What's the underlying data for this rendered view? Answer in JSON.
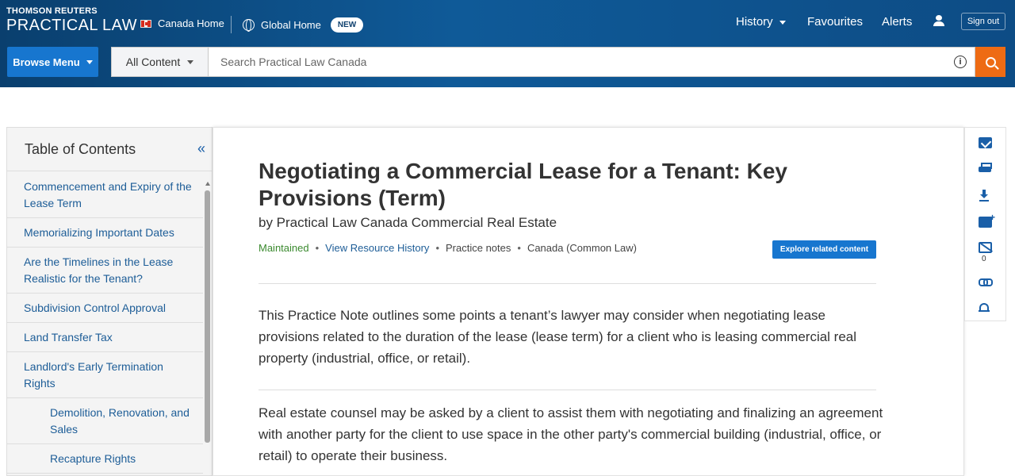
{
  "header": {
    "brand_top": "THOMSON REUTERS",
    "brand_bottom": "PRACTICAL LAW",
    "canada_home": "Canada Home",
    "global_home": "Global Home",
    "new_badge": "NEW",
    "nav": {
      "history": "History",
      "favourites": "Favourites",
      "alerts": "Alerts"
    },
    "sign_out": "Sign out"
  },
  "search": {
    "browse_menu": "Browse Menu",
    "scope": "All Content",
    "placeholder": "Search Practical Law Canada",
    "value": ""
  },
  "toc": {
    "title": "Table of Contents",
    "items": [
      {
        "label": "Commencement and Expiry of the Lease Term",
        "sub": false
      },
      {
        "label": "Memorializing Important Dates",
        "sub": false
      },
      {
        "label": "Are the Timelines in the Lease Realistic for the Tenant?",
        "sub": false
      },
      {
        "label": "Subdivision Control Approval",
        "sub": false
      },
      {
        "label": "Land Transfer Tax",
        "sub": false
      },
      {
        "label": "Landlord's Early Termination Rights",
        "sub": false
      },
      {
        "label": "Demolition, Renovation, and Sales",
        "sub": true
      },
      {
        "label": "Recapture Rights",
        "sub": true
      }
    ]
  },
  "document": {
    "title": "Negotiating a Commercial Lease for a Tenant: Key Provisions (Term)",
    "byline": "by Practical Law Canada Commercial Real Estate",
    "meta": {
      "status": "Maintained",
      "history_link": "View Resource History",
      "type": "Practice notes",
      "jurisdiction": "Canada (Common Law)"
    },
    "explore_button": "Explore related content",
    "paragraphs": [
      "This Practice Note outlines some points a tenant’s lawyer may consider when negotiating lease provisions related to the duration of the lease (lease term) for a client who is leasing commercial real property (industrial, office, or retail).",
      "Real estate counsel may be asked by a client to assist them with negotiating and finalizing an agreement with another party for the client to use space in the other party's commercial building (industrial, office, or retail) to operate their business."
    ]
  },
  "rail": {
    "icons": [
      "email-icon",
      "print-icon",
      "download-icon",
      "add-note-icon",
      "annotations-icon",
      "link-icon",
      "alert-bell-icon"
    ],
    "annotation_count": "0"
  },
  "colors": {
    "header_blue": "#0f5a98",
    "button_blue": "#1776cf",
    "search_orange": "#ee6b14",
    "link_blue": "#1d5d97",
    "maintained_green": "#3b8a2f"
  }
}
